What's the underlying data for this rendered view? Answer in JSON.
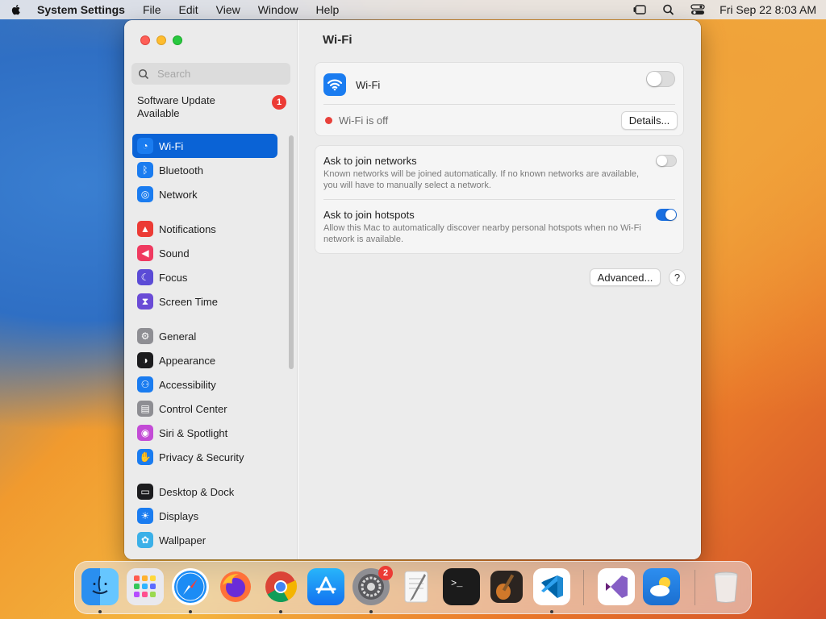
{
  "menubar": {
    "app_name": "System Settings",
    "menus": [
      "File",
      "Edit",
      "View",
      "Window",
      "Help"
    ],
    "clock": "Fri Sep 22  8:03 AM"
  },
  "window": {
    "search_placeholder": "Search",
    "software_update": {
      "label": "Software Update Available",
      "badge": "1"
    },
    "sidebar_groups": [
      [
        {
          "label": "Wi-Fi",
          "icon": "wifi-icon",
          "color": "#1a7cf0",
          "active": true
        },
        {
          "label": "Bluetooth",
          "icon": "bluetooth-icon",
          "color": "#1a7cf0"
        },
        {
          "label": "Network",
          "icon": "globe-icon",
          "color": "#1a7cf0"
        }
      ],
      [
        {
          "label": "Notifications",
          "icon": "bell-icon",
          "color": "#ec3b35"
        },
        {
          "label": "Sound",
          "icon": "speaker-icon",
          "color": "#ef3a60"
        },
        {
          "label": "Focus",
          "icon": "moon-icon",
          "color": "#5b4bd6"
        },
        {
          "label": "Screen Time",
          "icon": "hourglass-icon",
          "color": "#6a4bd6"
        }
      ],
      [
        {
          "label": "General",
          "icon": "gear-icon",
          "color": "#8e8e93"
        },
        {
          "label": "Appearance",
          "icon": "appearance-icon",
          "color": "#1c1c1e"
        },
        {
          "label": "Accessibility",
          "icon": "accessibility-icon",
          "color": "#1a7cf0"
        },
        {
          "label": "Control Center",
          "icon": "control-center-icon",
          "color": "#8e8e93"
        },
        {
          "label": "Siri & Spotlight",
          "icon": "siri-icon",
          "color": "#c34bd6"
        },
        {
          "label": "Privacy & Security",
          "icon": "hand-icon",
          "color": "#1a7cf0"
        }
      ],
      [
        {
          "label": "Desktop & Dock",
          "icon": "dock-icon",
          "color": "#1c1c1e"
        },
        {
          "label": "Displays",
          "icon": "sun-icon",
          "color": "#1a7cf0"
        },
        {
          "label": "Wallpaper",
          "icon": "flower-icon",
          "color": "#3bb0e8"
        }
      ]
    ]
  },
  "content": {
    "title": "Wi-Fi",
    "wifi_row_label": "Wi-Fi",
    "wifi_on": false,
    "status_text": "Wi-Fi is off",
    "details_button": "Details...",
    "ask_networks": {
      "title": "Ask to join networks",
      "desc": "Known networks will be joined automatically. If no known networks are available, you will have to manually select a network.",
      "on": false
    },
    "ask_hotspots": {
      "title": "Ask to join hotspots",
      "desc": "Allow this Mac to automatically discover nearby personal hotspots when no Wi-Fi network is available.",
      "on": true
    },
    "advanced_button": "Advanced...",
    "help_button": "?"
  },
  "dock": {
    "settings_badge": "2",
    "apps": [
      "finder-icon",
      "launchpad-icon",
      "safari-icon",
      "firefox-icon",
      "chrome-icon",
      "app-store-icon",
      "system-settings-icon",
      "textedit-icon",
      "terminal-icon",
      "garageband-icon",
      "vscode-icon",
      "visual-studio-icon",
      "weather-icon",
      "trash-icon"
    ]
  }
}
